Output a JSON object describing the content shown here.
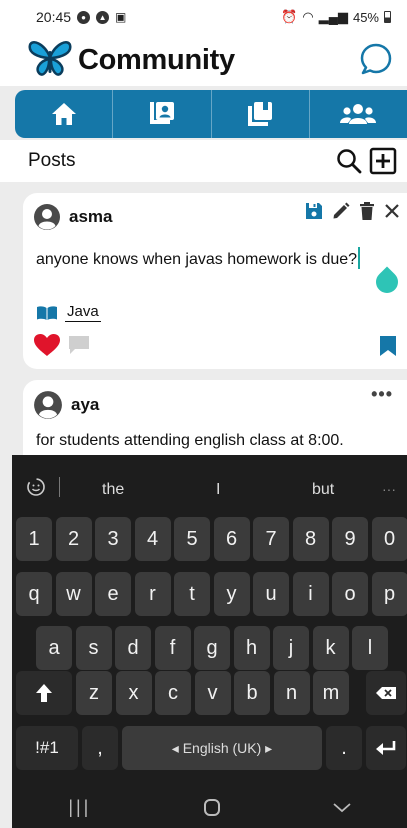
{
  "status": {
    "time": "20:45",
    "battery": "45%"
  },
  "app": {
    "title": "Community"
  },
  "nav": {
    "tabs": [
      "home",
      "contacts",
      "library",
      "people"
    ]
  },
  "posts_header": {
    "title": "Posts"
  },
  "posts": [
    {
      "author": "asma",
      "text": "anyone knows when javas homework is due?",
      "tag": "Java",
      "liked": true
    },
    {
      "author": "aya",
      "text": "for students attending english class at 8:00."
    }
  ],
  "keyboard": {
    "suggestions": [
      "the",
      "I",
      "but"
    ],
    "more": "···",
    "numbers": [
      "1",
      "2",
      "3",
      "4",
      "5",
      "6",
      "7",
      "8",
      "9",
      "0"
    ],
    "row1": [
      "q",
      "w",
      "e",
      "r",
      "t",
      "y",
      "u",
      "i",
      "o",
      "p"
    ],
    "row2": [
      "a",
      "s",
      "d",
      "f",
      "g",
      "h",
      "j",
      "k",
      "l"
    ],
    "row3": [
      "z",
      "x",
      "c",
      "v",
      "b",
      "n",
      "m"
    ],
    "symbols": "!#1",
    "comma": ",",
    "space": "◂ English (UK) ▸",
    "period": "."
  },
  "colors": {
    "brand": "#1577a8",
    "like": "#e0142b",
    "handle": "#2ec4b6"
  }
}
